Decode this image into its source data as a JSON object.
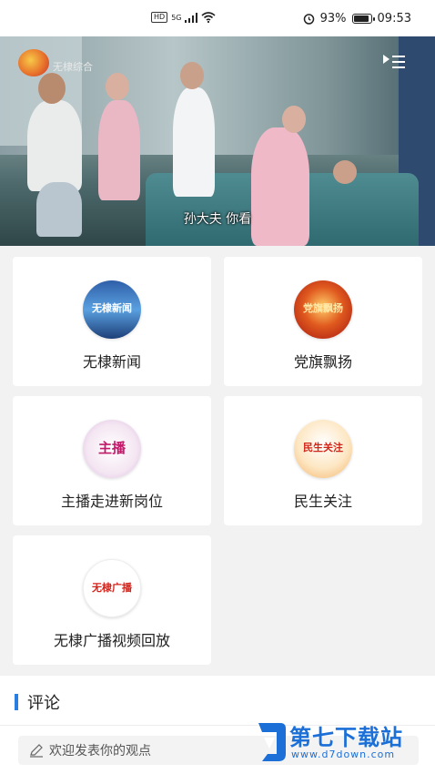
{
  "status_bar": {
    "network_tag": "HD",
    "network_type": "5G",
    "battery_percent": "93%",
    "battery_level": 0.93,
    "time": "09:53"
  },
  "video": {
    "channel_name": "无棣综合",
    "subtitle": "孙大夫 你看"
  },
  "grid": {
    "items": [
      {
        "label": "无棣新闻",
        "thumb_text": "无棣新闻",
        "icon": "news-thumb"
      },
      {
        "label": "党旗飘扬",
        "thumb_text": "党旗飘扬",
        "icon": "party-flag-thumb"
      },
      {
        "label": "主播走进新岗位",
        "thumb_text": "主播",
        "icon": "anchor-thumb"
      },
      {
        "label": "民生关注",
        "thumb_text": "民生关注",
        "icon": "livelihood-thumb"
      },
      {
        "label": "无棣广播视频回放",
        "thumb_text": "无棣广播",
        "icon": "radio-thumb"
      }
    ]
  },
  "comments": {
    "title": "评论",
    "placeholder": "欢迎发表你的观点"
  },
  "watermark": {
    "text": "第七下载站",
    "url": "www.d7down.com"
  },
  "colors": {
    "accent": "#2a7de1",
    "watermark": "#1b6fd6"
  }
}
